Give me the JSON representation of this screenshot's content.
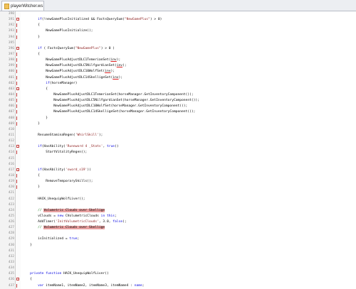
{
  "tab": {
    "title": "playerWitcher.ws"
  },
  "lines": [
    {
      "n": "390",
      "fold": "",
      "segs": []
    },
    {
      "n": "391",
      "fold": "open",
      "segs": [
        {
          "t": "        "
        },
        {
          "t": "if",
          "c": "kw"
        },
        {
          "t": "(!newGamePlusInitialized && FactsQuerySum("
        },
        {
          "t": "\"NewGamePlus\"",
          "c": "str"
        },
        {
          "t": ") > 0)"
        }
      ]
    },
    {
      "n": "392",
      "fold": "line",
      "segs": [
        {
          "t": "        {"
        }
      ]
    },
    {
      "n": "393",
      "fold": "line",
      "segs": [
        {
          "t": "            NewGamePlusInitialize();"
        }
      ]
    },
    {
      "n": "394",
      "fold": "line",
      "segs": [
        {
          "t": "        }"
        }
      ]
    },
    {
      "n": "395",
      "fold": "",
      "segs": []
    },
    {
      "n": "396",
      "fold": "open",
      "segs": [
        {
          "t": "        "
        },
        {
          "t": "if",
          "c": "kw"
        },
        {
          "t": " ( FactsQuerySum("
        },
        {
          "t": "\"NewGamePlus\"",
          "c": "str"
        },
        {
          "t": ") > 0 )"
        }
      ]
    },
    {
      "n": "397",
      "fold": "line",
      "segs": [
        {
          "t": "        {"
        }
      ]
    },
    {
      "n": "398",
      "fold": "line",
      "segs": [
        {
          "t": "            NewGamePlusAdjustDLC1TemerianSet("
        },
        {
          "t": "inv",
          "c": "ul"
        },
        {
          "t": ");"
        }
      ]
    },
    {
      "n": "399",
      "fold": "line",
      "segs": [
        {
          "t": "            NewGamePlusAdjustDLC5NilfgardianSet("
        },
        {
          "t": "inv",
          "c": "ul"
        },
        {
          "t": ");"
        }
      ]
    },
    {
      "n": "400",
      "fold": "line",
      "segs": [
        {
          "t": "            NewGamePlusAdjustDLC10WolfSet("
        },
        {
          "t": "inv",
          "c": "ul"
        },
        {
          "t": ");"
        }
      ]
    },
    {
      "n": "401",
      "fold": "line",
      "segs": [
        {
          "t": "            NewGamePlusAdjustDLC14SkelligeSet("
        },
        {
          "t": "inv",
          "c": "ul"
        },
        {
          "t": ");"
        }
      ]
    },
    {
      "n": "402",
      "fold": "line",
      "segs": [
        {
          "t": "            "
        },
        {
          "t": "if",
          "c": "kw"
        },
        {
          "t": "(horseManager)"
        }
      ]
    },
    {
      "n": "403",
      "fold": "open",
      "segs": [
        {
          "t": "            {"
        }
      ]
    },
    {
      "n": "404",
      "fold": "line",
      "segs": [
        {
          "t": "                NewGamePlusAdjustDLC1TemerianSet(horseManager.GetInventoryComponent());"
        }
      ]
    },
    {
      "n": "405",
      "fold": "line",
      "segs": [
        {
          "t": "                NewGamePlusAdjustDLC5NilfgardianSet(horseManager.GetInventoryComponent());"
        }
      ]
    },
    {
      "n": "406",
      "fold": "line",
      "segs": [
        {
          "t": "                NewGamePlusAdjustDLC10WolfSet(horseManager.GetInventoryComponent());"
        }
      ]
    },
    {
      "n": "407",
      "fold": "line",
      "segs": [
        {
          "t": "                NewGamePlusAdjustDLC14SkelligeSet(horseManager.GetInventoryComponent());"
        }
      ]
    },
    {
      "n": "408",
      "fold": "line",
      "segs": [
        {
          "t": "            }"
        }
      ]
    },
    {
      "n": "409",
      "fold": "line",
      "segs": [
        {
          "t": "        }"
        }
      ]
    },
    {
      "n": "410",
      "fold": "",
      "segs": []
    },
    {
      "n": "411",
      "fold": "",
      "segs": [
        {
          "t": "        ResumeStaminaRegen("
        },
        {
          "t": "'WhirlSkill'",
          "c": "str"
        },
        {
          "t": ");"
        }
      ]
    },
    {
      "n": "412",
      "fold": "",
      "segs": []
    },
    {
      "n": "413",
      "fold": "open",
      "segs": [
        {
          "t": "        "
        },
        {
          "t": "if",
          "c": "kw"
        },
        {
          "t": "(HasAbility("
        },
        {
          "t": "'Runeword 4 _Stats'",
          "c": "str"
        },
        {
          "t": ", "
        },
        {
          "t": "true",
          "c": "kw"
        },
        {
          "t": "))"
        }
      ]
    },
    {
      "n": "414",
      "fold": "line",
      "segs": [
        {
          "t": "            StartVitalityRegen();"
        }
      ]
    },
    {
      "n": "415",
      "fold": "",
      "segs": []
    },
    {
      "n": "416",
      "fold": "",
      "segs": []
    },
    {
      "n": "417",
      "fold": "open",
      "segs": [
        {
          "t": "        "
        },
        {
          "t": "if",
          "c": "kw"
        },
        {
          "t": "(HasAbility("
        },
        {
          "t": "'sword_s19'",
          "c": "str"
        },
        {
          "t": "))"
        }
      ]
    },
    {
      "n": "418",
      "fold": "line",
      "segs": [
        {
          "t": "        {"
        }
      ]
    },
    {
      "n": "419",
      "fold": "line",
      "segs": [
        {
          "t": "            RemoveTemporarySkills();"
        }
      ]
    },
    {
      "n": "420",
      "fold": "line",
      "segs": [
        {
          "t": "        }"
        }
      ]
    },
    {
      "n": "421",
      "fold": "",
      "segs": []
    },
    {
      "n": "422",
      "fold": "",
      "segs": [
        {
          "t": "        HACK_UnequipWolfLiver();"
        }
      ]
    },
    {
      "n": "423",
      "fold": "",
      "segs": []
    },
    {
      "n": "424",
      "fold": "",
      "segs": [
        {
          "t": "        // ",
          "c": "cmt"
        },
        {
          "t": "Volumetric Clouds over Skellige",
          "c": "hl"
        }
      ]
    },
    {
      "n": "425",
      "fold": "",
      "segs": [
        {
          "t": "        vClouds = "
        },
        {
          "t": "new",
          "c": "kw"
        },
        {
          "t": " CVolumetricClouds "
        },
        {
          "t": "in",
          "c": "kw"
        },
        {
          "t": " "
        },
        {
          "t": "this",
          "c": "kw"
        },
        {
          "t": ";"
        }
      ]
    },
    {
      "n": "426",
      "fold": "",
      "segs": [
        {
          "t": "        AddTimer("
        },
        {
          "t": "'InitVolumetricClouds'",
          "c": "str"
        },
        {
          "t": ", 3.0, "
        },
        {
          "t": "false",
          "c": "kw"
        },
        {
          "t": ");"
        }
      ]
    },
    {
      "n": "427",
      "fold": "",
      "segs": [
        {
          "t": "        // ",
          "c": "cmt"
        },
        {
          "t": "Volumetric Clouds over Skellige",
          "c": "hl"
        }
      ]
    },
    {
      "n": "428",
      "fold": "",
      "segs": []
    },
    {
      "n": "429",
      "fold": "",
      "segs": [
        {
          "t": "        isInitialized = "
        },
        {
          "t": "true",
          "c": "kw"
        },
        {
          "t": ";"
        }
      ]
    },
    {
      "n": "430",
      "fold": "",
      "segs": [
        {
          "t": "    }"
        }
      ]
    },
    {
      "n": "431",
      "fold": "",
      "segs": []
    },
    {
      "n": "432",
      "fold": "",
      "segs": []
    },
    {
      "n": "433",
      "fold": "",
      "segs": []
    },
    {
      "n": "434",
      "fold": "",
      "segs": []
    },
    {
      "n": "435",
      "fold": "",
      "segs": [
        {
          "t": "    "
        },
        {
          "t": "private",
          "c": "kw"
        },
        {
          "t": " "
        },
        {
          "t": "function",
          "c": "kw"
        },
        {
          "t": " HACK_UnequipWolfLiver()"
        }
      ]
    },
    {
      "n": "436",
      "fold": "open",
      "segs": [
        {
          "t": "    {"
        }
      ]
    },
    {
      "n": "437",
      "fold": "line",
      "segs": [
        {
          "t": "        "
        },
        {
          "t": "var",
          "c": "kw"
        },
        {
          "t": " itemName1, itemName2, itemName3, itemName4 : "
        },
        {
          "t": "name",
          "c": "kw"
        },
        {
          "t": ";"
        }
      ]
    }
  ]
}
